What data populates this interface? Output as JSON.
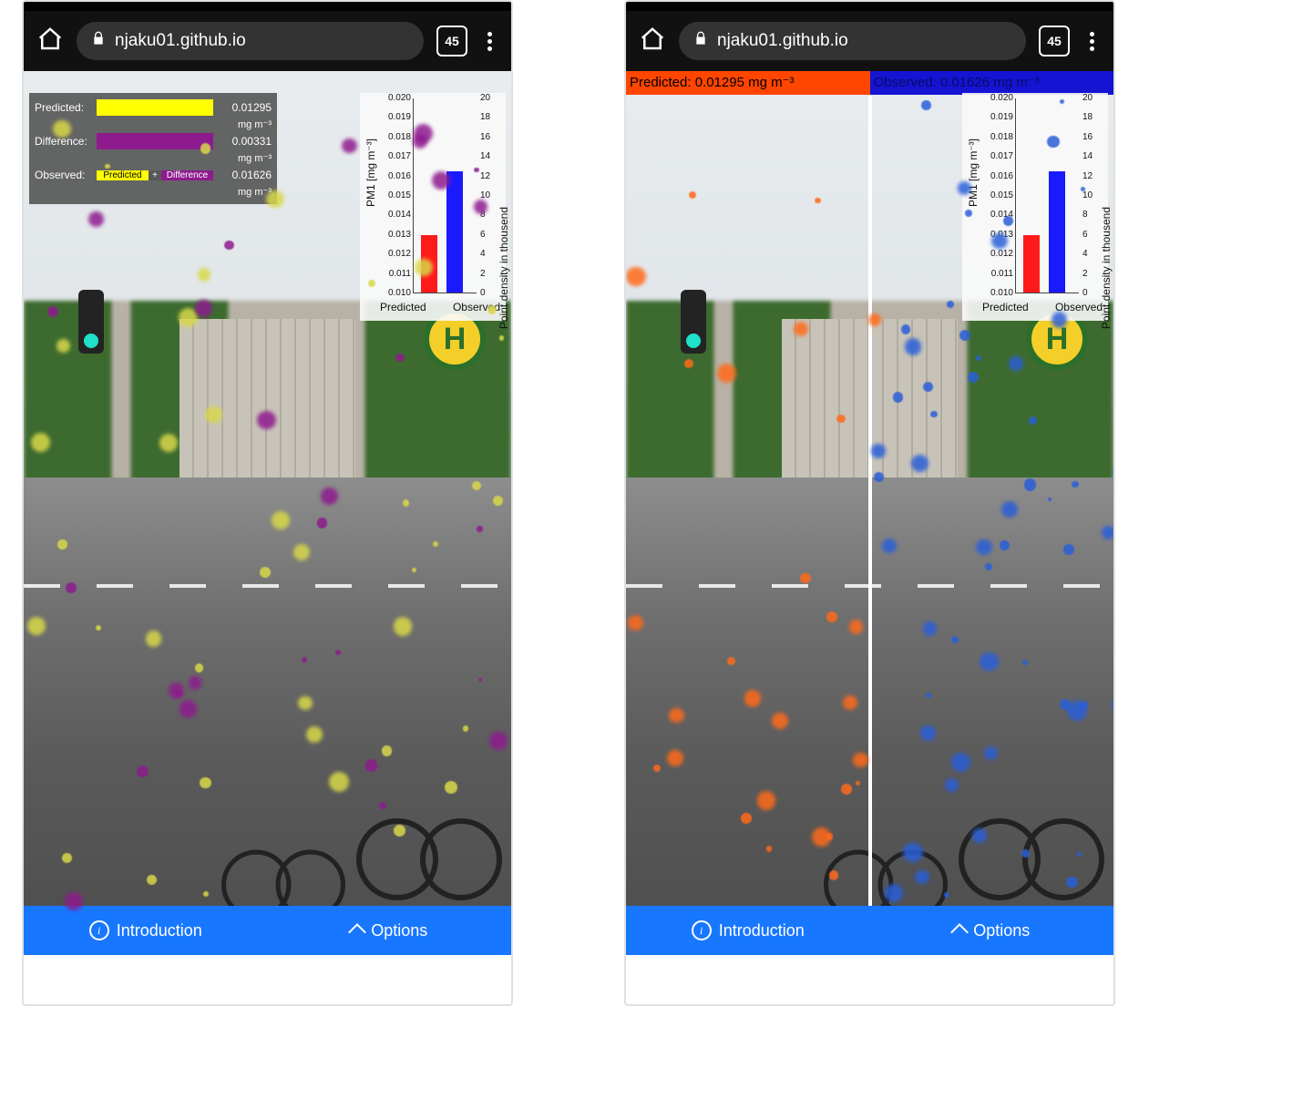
{
  "browser": {
    "url_host": "njaku01.github.io",
    "tab_count": "45"
  },
  "nav": {
    "introduction": "Introduction",
    "options": "Options"
  },
  "left": {
    "legend": {
      "predicted_label": "Predicted:",
      "predicted_value": "0.01295",
      "difference_label": "Difference:",
      "difference_value": "0.00331",
      "observed_label": "Observed:",
      "observed_value": "0.01626",
      "unit": "mg m⁻³",
      "combo_left": "Predicted",
      "combo_plus": "+",
      "combo_right": "Difference"
    },
    "particle_colors": {
      "a": "#d8d84a",
      "b": "#8e1b8e"
    }
  },
  "right": {
    "banner_predicted": "Predicted: 0.01295 mg m⁻³",
    "banner_observed": "Observed: 0.01626 mg m⁻³",
    "particle_colors": {
      "a": "#ff6a1a",
      "b": "#2a5fd8"
    }
  },
  "chart": {
    "ylabel_left": "PM1 [mg m⁻³]",
    "ylabel_right": "Point density in thousend",
    "xlabel_left": "Predicted",
    "xlabel_right": "Observed",
    "left_ticks": [
      "0.020",
      "0.019",
      "0.018",
      "0.017",
      "0.016",
      "0.015",
      "0.014",
      "0.013",
      "0.012",
      "0.011",
      "0.010"
    ],
    "right_ticks": [
      "20",
      "18",
      "16",
      "14",
      "12",
      "10",
      "8",
      "6",
      "4",
      "2",
      "0"
    ]
  },
  "chart_data": {
    "type": "bar",
    "title": "",
    "xlabel": "",
    "ylabel_left": "PM1 [mg m⁻³]",
    "ylabel_right": "Point density in thousend",
    "ylim_left": [
      0.01,
      0.02
    ],
    "ylim_right": [
      0,
      20
    ],
    "series": [
      {
        "name": "Predicted",
        "axis": "left",
        "color": "#ff1a1a",
        "value": 0.01295
      },
      {
        "name": "Observed",
        "axis": "left",
        "color": "#1a1aff",
        "value": 0.01626
      }
    ],
    "right_axis_equivalent": {
      "Predicted": 5.9,
      "Observed": 12.5
    }
  }
}
